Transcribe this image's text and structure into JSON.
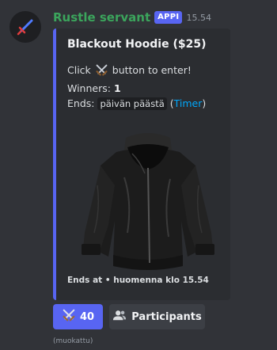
{
  "message": {
    "author": "Rustle servant",
    "badge": "APPI",
    "timestamp": "15.54",
    "edited_label": "(muokattu)"
  },
  "embed": {
    "accent_color": "#5865f2",
    "title": "Blackout Hoodie ($25)",
    "line1_prefix": "Click",
    "line1_icon": "crossed-swords-icon",
    "line1_suffix": "button to enter!",
    "winners_label": "Winners:",
    "winners_value": "1",
    "ends_label": "Ends:",
    "ends_value": "päivän päästä",
    "ends_link_open": "(",
    "ends_link": "Timer",
    "ends_link_close": ")",
    "image_icon": "black-hoodie-image",
    "footer_label": "Ends at",
    "footer_sep": "•",
    "footer_value": "huomenna klo 15.54"
  },
  "buttons": {
    "enter_icon": "crossed-swords-icon",
    "enter_count": "40",
    "participants_icon": "users-icon",
    "participants_label": "Participants"
  },
  "colors": {
    "background": "#313338",
    "embed_background": "#2b2d31",
    "username": "#3ba55c",
    "blurple": "#5865f2",
    "link": "#00a8fc"
  }
}
